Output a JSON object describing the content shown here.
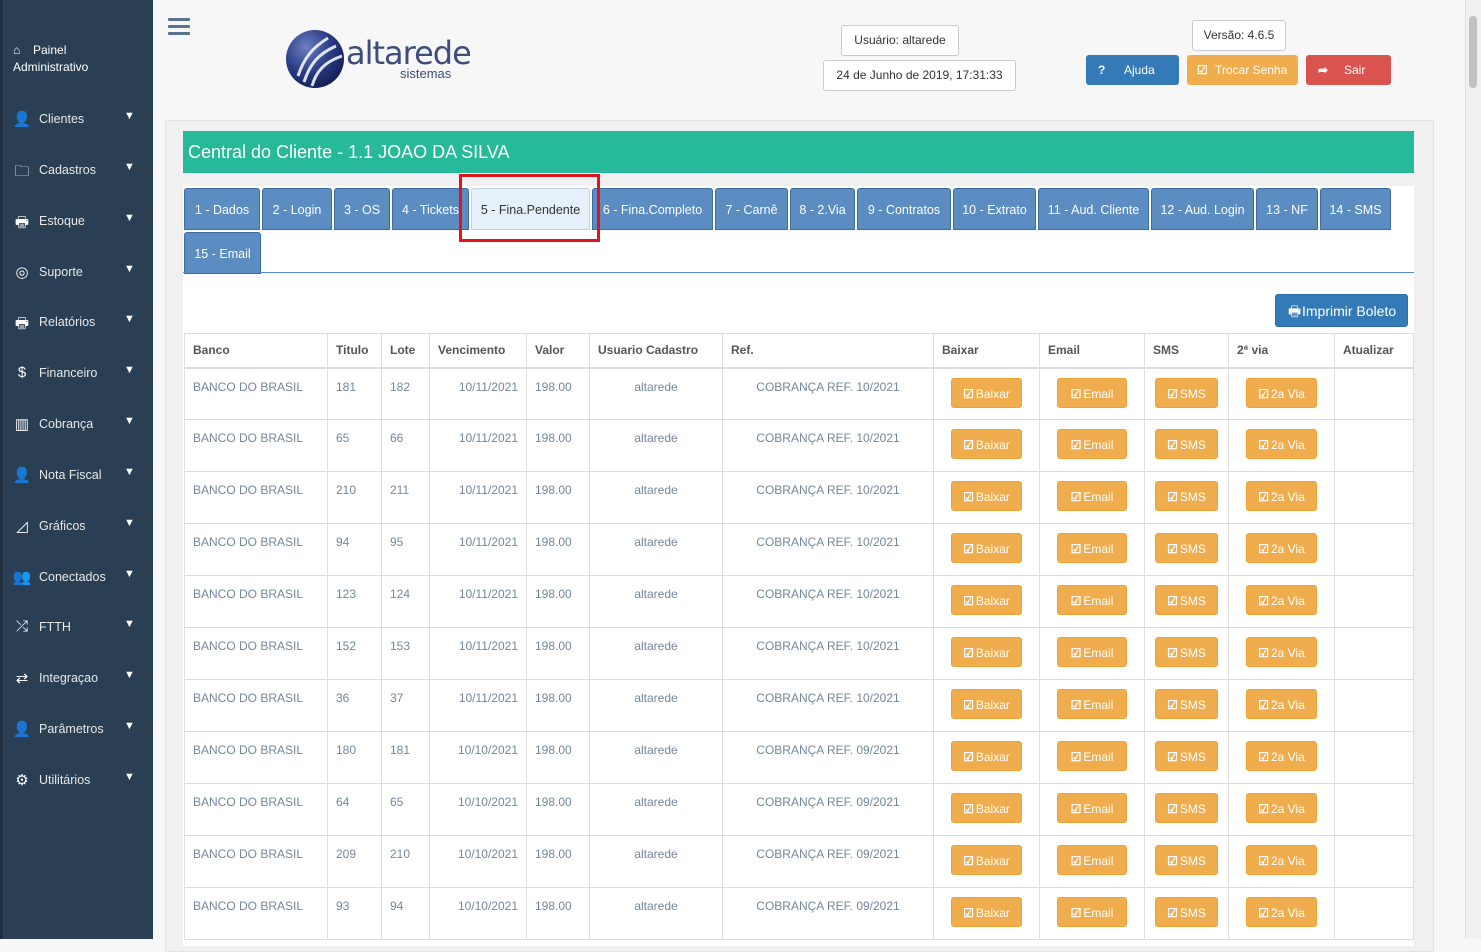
{
  "sidebar": {
    "title_line1": "Painel",
    "title_line2": "Administrativo",
    "items": [
      {
        "label": "Clientes",
        "icon": "user-icon"
      },
      {
        "label": "Cadastros",
        "icon": "folder-icon"
      },
      {
        "label": "Estoque",
        "icon": "print-icon"
      },
      {
        "label": "Suporte",
        "icon": "lifebuoy-icon"
      },
      {
        "label": "Relatórios",
        "icon": "print-icon"
      },
      {
        "label": "Financeiro",
        "icon": "dollar-icon"
      },
      {
        "label": "Cobrança",
        "icon": "barcode-icon"
      },
      {
        "label": "Nota Fiscal",
        "icon": "user-icon"
      },
      {
        "label": "Gráficos",
        "icon": "area-chart-icon"
      },
      {
        "label": "Conectados",
        "icon": "users-icon"
      },
      {
        "label": "FTTH",
        "icon": "random-icon"
      },
      {
        "label": "Integraçao",
        "icon": "exchange-icon"
      },
      {
        "label": "Parâmetros",
        "icon": "user-icon"
      },
      {
        "label": "Utilitários",
        "icon": "cogs-icon"
      }
    ]
  },
  "header": {
    "logo_text": "altarede",
    "logo_sub": "sistemas",
    "user": "Usuário: altarede",
    "datetime": "24 de Junho de 2019, 17:31:33",
    "version": "Versão: 4.6.5",
    "help_label": "Ajuda",
    "change_password_label": "Trocar Senha",
    "logout_label": "Sair",
    "colors": {
      "help": "#337ab7",
      "change_password": "#f0ad4e",
      "logout": "#d9534f"
    }
  },
  "panel": {
    "title": "Central do Cliente - 1.1 JOAO DA SILVA",
    "accent": "#26b99a"
  },
  "tabs": [
    "1 - Dados",
    "2 - Login",
    "3 - OS",
    "4 - Tickets",
    "5 - Fina.Pendente",
    "6 - Fina.Completo",
    "7 - Carnê",
    "8 - 2.Via",
    "9 - Contratos",
    "10 - Extrato",
    "11 - Aud. Cliente",
    "12 - Aud. Login",
    "13 - NF",
    "14 - SMS",
    "15 - Email"
  ],
  "active_tab": "5 - Fina.Pendente",
  "print_label": "Imprimir Boleto",
  "table": {
    "columns": [
      "Banco",
      "Titulo",
      "Lote",
      "Vencimento",
      "Valor",
      "Usuario Cadastro",
      "Ref.",
      "Baixar",
      "Email",
      "SMS",
      "2ª via",
      "Atualizar"
    ],
    "action_labels": {
      "baixar": "Baixar",
      "email": "Email",
      "sms": "SMS",
      "via": "2a Via"
    },
    "rows": [
      [
        "BANCO DO BRASIL",
        "181",
        "182",
        "10/11/2021",
        "198.00",
        "altarede",
        "COBRANÇA REF. 10/2021"
      ],
      [
        "BANCO DO BRASIL",
        "65",
        "66",
        "10/11/2021",
        "198.00",
        "altarede",
        "COBRANÇA REF. 10/2021"
      ],
      [
        "BANCO DO BRASIL",
        "210",
        "211",
        "10/11/2021",
        "198.00",
        "altarede",
        "COBRANÇA REF. 10/2021"
      ],
      [
        "BANCO DO BRASIL",
        "94",
        "95",
        "10/11/2021",
        "198.00",
        "altarede",
        "COBRANÇA REF. 10/2021"
      ],
      [
        "BANCO DO BRASIL",
        "123",
        "124",
        "10/11/2021",
        "198.00",
        "altarede",
        "COBRANÇA REF. 10/2021"
      ],
      [
        "BANCO DO BRASIL",
        "152",
        "153",
        "10/11/2021",
        "198.00",
        "altarede",
        "COBRANÇA REF. 10/2021"
      ],
      [
        "BANCO DO BRASIL",
        "36",
        "37",
        "10/11/2021",
        "198.00",
        "altarede",
        "COBRANÇA REF. 10/2021"
      ],
      [
        "BANCO DO BRASIL",
        "180",
        "181",
        "10/10/2021",
        "198.00",
        "altarede",
        "COBRANÇA REF. 09/2021"
      ],
      [
        "BANCO DO BRASIL",
        "64",
        "65",
        "10/10/2021",
        "198.00",
        "altarede",
        "COBRANÇA REF. 09/2021"
      ],
      [
        "BANCO DO BRASIL",
        "209",
        "210",
        "10/10/2021",
        "198.00",
        "altarede",
        "COBRANÇA REF. 09/2021"
      ],
      [
        "BANCO DO BRASIL",
        "93",
        "94",
        "10/10/2021",
        "198.00",
        "altarede",
        "COBRANÇA REF. 09/2021"
      ]
    ]
  }
}
